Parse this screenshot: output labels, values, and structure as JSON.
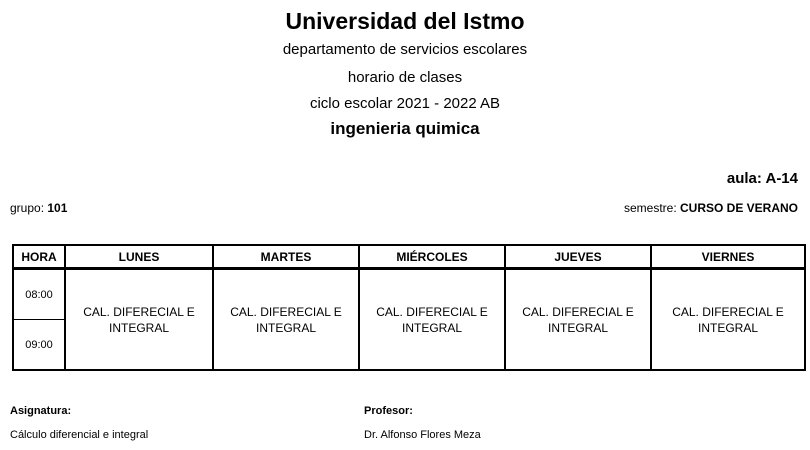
{
  "header": {
    "university": "Universidad del Istmo",
    "department": "departamento de servicios escolares",
    "document_title": "horario de clases",
    "school_cycle": "ciclo escolar 2021 - 2022 AB",
    "career": "ingenieria quimica"
  },
  "info": {
    "aula_label": "aula: ",
    "aula_value": "A-14",
    "grupo_label": "grupo: ",
    "grupo_value": "101",
    "semestre_label": "semestre: ",
    "semestre_value": "CURSO DE VERANO"
  },
  "schedule": {
    "headers": [
      "HORA",
      "LUNES",
      "MARTES",
      "MIÉRCOLES",
      "JUEVES",
      "VIERNES"
    ],
    "hours": [
      "08:00",
      "09:00"
    ],
    "classes": [
      "CAL. DIFERECIAL E INTEGRAL",
      "CAL. DIFERECIAL E INTEGRAL",
      "CAL. DIFERECIAL E INTEGRAL",
      "CAL. DIFERECIAL E INTEGRAL",
      "CAL. DIFERECIAL E INTEGRAL"
    ]
  },
  "footer": {
    "asignatura_label": "Asignatura:",
    "asignatura_value": "Cálculo diferencial e integral",
    "profesor_label": "Profesor:",
    "profesor_value": "Dr. Alfonso Flores Meza"
  }
}
